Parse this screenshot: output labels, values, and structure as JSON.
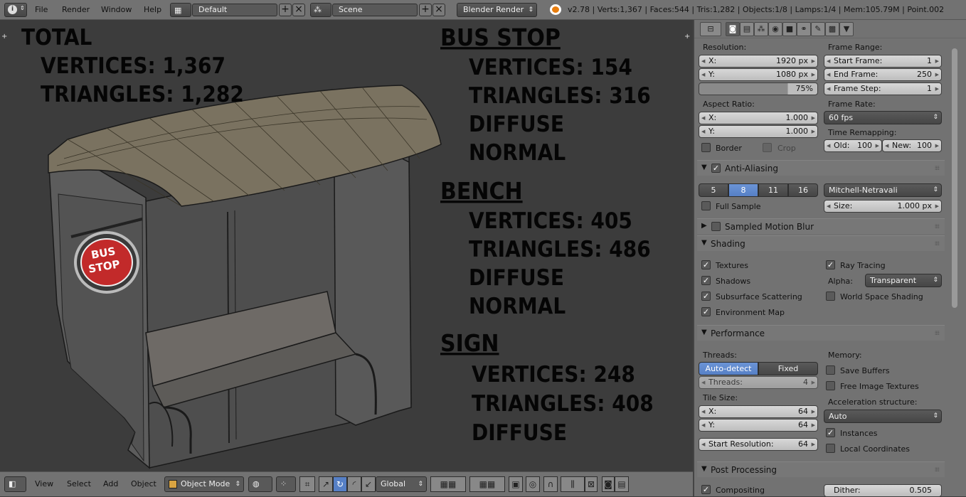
{
  "top": {
    "menus": [
      "File",
      "Render",
      "Window",
      "Help"
    ],
    "layout": "Default",
    "scene": "Scene",
    "engine": "Blender Render",
    "stats": "v2.78 | Verts:1,367 | Faces:544 | Tris:1,282 | Objects:1/8 | Lamps:1/4 | Mem:105.79M | Point.002"
  },
  "viewport": {
    "total": "TOTAL",
    "total_vertices": "VERTICES: 1,367",
    "total_triangles": "TRIANGLES: 1,282",
    "busstop_title": "BUS STOP",
    "busstop_vertices": "VERTICES: 154",
    "busstop_triangles": "TRIANGLES: 316",
    "busstop_diffuse": "DIFFUSE",
    "busstop_normal": "NORMAL",
    "bench_title": "BENCH",
    "bench_vertices": "VERTICES: 405",
    "bench_triangles": "TRIANGLES: 486",
    "bench_diffuse": "DIFFUSE",
    "bench_normal": "NORMAL",
    "sign_title": "SIGN",
    "sign_vertices": "VERTICES: 248",
    "sign_triangles": "TRIANGLES: 408",
    "sign_diffuse": "DIFFUSE",
    "sign_text_1": "BUS",
    "sign_text_2": "STOP"
  },
  "bottom": {
    "menus": [
      "View",
      "Select",
      "Add",
      "Object"
    ],
    "mode": "Object Mode",
    "orientation": "Global"
  },
  "panel": {
    "resolution_label": "Resolution:",
    "res_x_label": "X:",
    "res_x": "1920 px",
    "res_y_label": "Y:",
    "res_y": "1080 px",
    "res_pct": "75%",
    "frame_range_label": "Frame Range:",
    "start_frame_label": "Start Frame:",
    "start_frame": "1",
    "end_frame_label": "End Frame:",
    "end_frame": "250",
    "frame_step_label": "Frame Step:",
    "frame_step": "1",
    "aspect_label": "Aspect Ratio:",
    "aspect_x_label": "X:",
    "aspect_x": "1.000",
    "aspect_y_label": "Y:",
    "aspect_y": "1.000",
    "frame_rate_label": "Frame Rate:",
    "frame_rate": "60 fps",
    "time_remap_label": "Time Remapping:",
    "old_label": "Old:",
    "old": "100",
    "new_label": "New:",
    "new": "100",
    "border": "Border",
    "crop": "Crop",
    "aa_title": "Anti-Aliasing",
    "aa_samples": [
      "5",
      "8",
      "11",
      "16"
    ],
    "aa_filter": "Mitchell-Netravali",
    "full_sample": "Full Sample",
    "size_label": "Size:",
    "size": "1.000 px",
    "motion_blur": "Sampled Motion Blur",
    "shading_title": "Shading",
    "textures": "Textures",
    "shadows": "Shadows",
    "sss": "Subsurface Scattering",
    "env_map": "Environment Map",
    "ray_tracing": "Ray Tracing",
    "alpha_label": "Alpha:",
    "alpha": "Transparent",
    "world_space": "World Space Shading",
    "performance_title": "Performance",
    "threads_label": "Threads:",
    "auto_detect": "Auto-detect",
    "fixed": "Fixed",
    "threads_field_label": "Threads:",
    "threads_value": "4",
    "tile_size_label": "Tile Size:",
    "tile_x_label": "X:",
    "tile_x": "64",
    "tile_y_label": "Y:",
    "tile_y": "64",
    "start_res_label": "Start Resolution:",
    "start_res": "64",
    "memory_label": "Memory:",
    "save_buffers": "Save Buffers",
    "free_textures": "Free Image Textures",
    "accel_label": "Acceleration structure:",
    "accel": "Auto",
    "instances": "Instances",
    "local_coords": "Local Coordinates",
    "post_title": "Post Processing",
    "compositing": "Compositing",
    "dither_label": "Dither:",
    "dither": "0.505"
  },
  "colors": {
    "selected_blue": "#5680c6",
    "sign_red": "#c22a2a"
  }
}
